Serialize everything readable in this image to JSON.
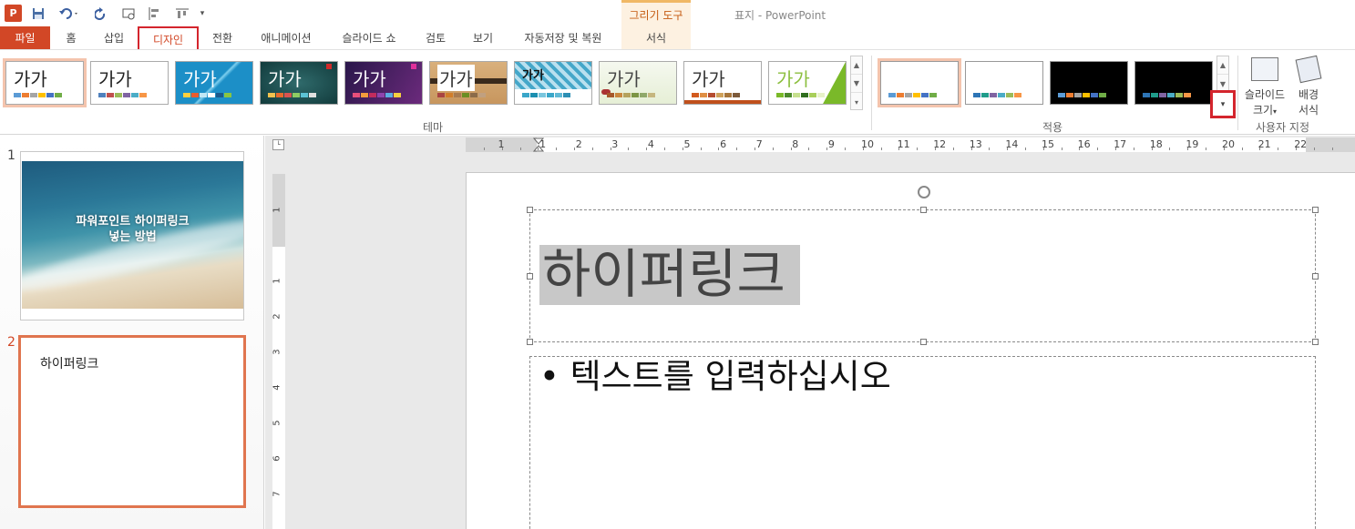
{
  "window": {
    "title": "표지 - PowerPoint",
    "app_logo": "P"
  },
  "quick_access": {
    "icons": [
      "powerpoint-logo-icon",
      "save-icon",
      "undo-icon",
      "redo-icon",
      "slideshow-icon",
      "align-icon",
      "arrange-icon",
      "customize-icon"
    ]
  },
  "context_tab": {
    "header": "그리기 도구",
    "tab": "서식"
  },
  "tabs": {
    "file": "파일",
    "home": "홈",
    "insert": "삽입",
    "design": "디자인",
    "transitions": "전환",
    "animations": "애니메이션",
    "slideshow": "슬라이드 쇼",
    "review": "검토",
    "view": "보기",
    "autosave": "자동저장 및 복원"
  },
  "ribbon": {
    "theme_sample_text": "가가",
    "themes_group_label": "테마",
    "variants_group_label": "적용",
    "customize_group_label": "사용자 지정",
    "slide_size_label_line1": "슬라이드",
    "slide_size_label_line2": "크기",
    "format_bg_label_line1": "배경",
    "format_bg_label_line2": "서식"
  },
  "thumbnails": {
    "slide1": {
      "number": "1",
      "title_line1": "파워포인트 하이퍼링크",
      "title_line2": "넣는 방법"
    },
    "slide2": {
      "number": "2",
      "title": "하이퍼링크"
    }
  },
  "slide": {
    "title": "하이퍼링크",
    "body_bullet": "•",
    "body_text": "텍스트를 입력하십시오"
  },
  "ruler": {
    "h_labels": [
      "1",
      "1",
      "2",
      "3",
      "4",
      "5",
      "6",
      "7",
      "8",
      "9",
      "10",
      "11",
      "12",
      "13",
      "14",
      "15",
      "16",
      "17",
      "18",
      "19",
      "20",
      "21",
      "22"
    ],
    "v_labels": [
      "1",
      "1",
      "2",
      "3",
      "4",
      "5",
      "6",
      "7"
    ]
  },
  "colors": {
    "accent": "#d24726",
    "highlight_red": "#d4252d",
    "context_orange": "#c55a11",
    "selection_border": "#e0754f"
  }
}
